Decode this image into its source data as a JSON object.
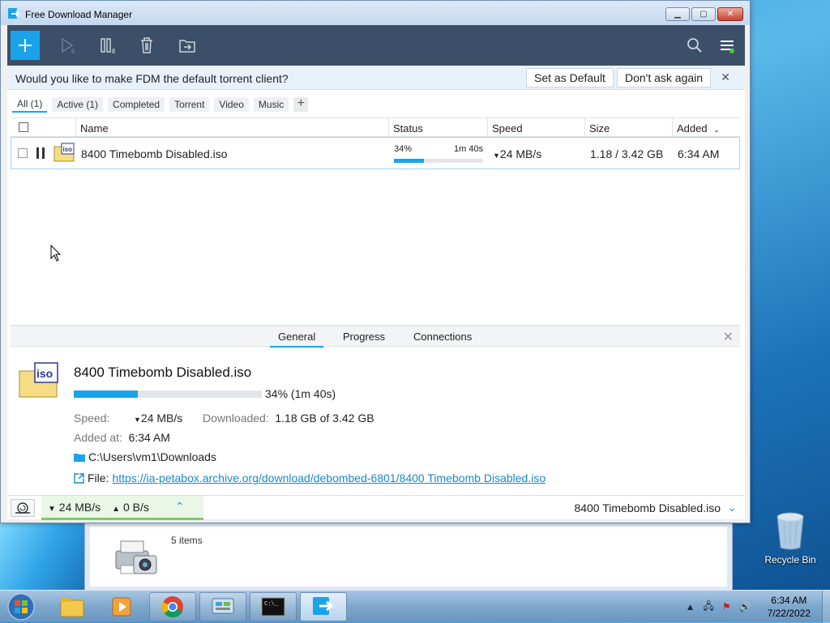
{
  "window": {
    "title": "Free Download Manager"
  },
  "banner": {
    "message": "Would you like to make FDM the default torrent client?",
    "set_default": "Set as Default",
    "dont_ask": "Don't ask again",
    "close": "✕"
  },
  "filters": [
    "All (1)",
    "Active (1)",
    "Completed",
    "Torrent",
    "Video",
    "Music"
  ],
  "filter_add": "+",
  "columns": {
    "name": "Name",
    "status": "Status",
    "speed": "Speed",
    "size": "Size",
    "added": "Added"
  },
  "download": {
    "name": "8400 Timebomb Disabled.iso",
    "percent": "34%",
    "progress": 0.34,
    "eta": "1m 40s",
    "speed": "24 MB/s",
    "size": "1.18 / 3.42 GB",
    "added": "6:34 AM",
    "file_icon_text": "iso"
  },
  "details": {
    "tabs": [
      "General",
      "Progress",
      "Connections"
    ],
    "name": "8400 Timebomb Disabled.iso",
    "progress_text": "34% (1m 40s)",
    "speed_label": "Speed:",
    "speed_value": "24 MB/s",
    "downloaded_label": "Downloaded:",
    "downloaded_value": "1.18 GB of 3.42 GB",
    "added_label": "Added at:",
    "added_value": "6:34 AM",
    "folder": "C:\\Users\\vm1\\Downloads",
    "file_label": "File:",
    "file_url": "https://ia-petabox.archive.org/download/debombed-6801/8400 Timebomb Disabled.iso"
  },
  "statusbar": {
    "down_speed": "24 MB/s",
    "up_speed": "0 B/s",
    "current_file": "8400 Timebomb Disabled.iso"
  },
  "explorer": {
    "items_count": "5 items"
  },
  "desktop": {
    "recycle_bin": "Recycle Bin"
  },
  "tray": {
    "time": "6:34 AM",
    "date": "7/22/2022"
  },
  "colors": {
    "accent": "#1aa3e8",
    "toolbar": "#3c4f68",
    "speed_ok": "#7ecb63"
  }
}
